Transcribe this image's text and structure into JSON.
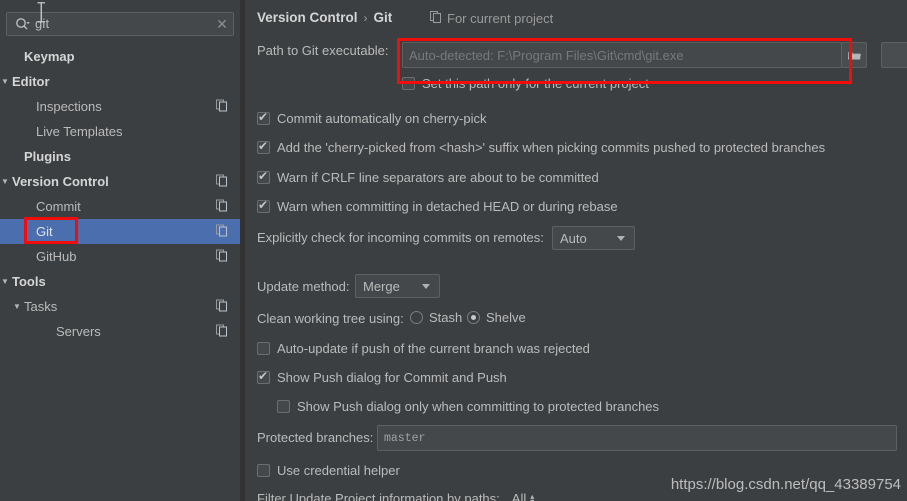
{
  "search": {
    "value": "git",
    "icon": "search-icon",
    "clear_icon": "clear-x-icon"
  },
  "sidebar": {
    "items": [
      {
        "label": "Keymap",
        "indent": 1,
        "bold": true,
        "arrow": "",
        "project_icon": false,
        "selected": false
      },
      {
        "label": "Editor",
        "indent": 0,
        "bold": true,
        "arrow": "▼",
        "project_icon": false,
        "selected": false
      },
      {
        "label": "Inspections",
        "indent": 2,
        "bold": false,
        "arrow": "",
        "project_icon": true,
        "selected": false
      },
      {
        "label": "Live Templates",
        "indent": 2,
        "bold": false,
        "arrow": "",
        "project_icon": false,
        "selected": false
      },
      {
        "label": "Plugins",
        "indent": 1,
        "bold": true,
        "arrow": "",
        "project_icon": false,
        "selected": false
      },
      {
        "label": "Version Control",
        "indent": 0,
        "bold": true,
        "arrow": "▼",
        "project_icon": true,
        "selected": false
      },
      {
        "label": "Commit",
        "indent": 2,
        "bold": false,
        "arrow": "",
        "project_icon": true,
        "selected": false
      },
      {
        "label": "Git",
        "indent": 2,
        "bold": false,
        "arrow": "",
        "project_icon": true,
        "selected": true
      },
      {
        "label": "GitHub",
        "indent": 2,
        "bold": false,
        "arrow": "",
        "project_icon": true,
        "selected": false
      },
      {
        "label": "Tools",
        "indent": 0,
        "bold": true,
        "arrow": "▼",
        "project_icon": false,
        "selected": false
      },
      {
        "label": "Tasks",
        "indent": 1,
        "bold": false,
        "arrow": "▼",
        "project_icon": true,
        "selected": false
      },
      {
        "label": "Servers",
        "indent": 3,
        "bold": false,
        "arrow": "",
        "project_icon": true,
        "selected": false
      }
    ]
  },
  "header": {
    "breadcrumb_root": "Version Control",
    "breadcrumb_sep": "›",
    "breadcrumb_leaf": "Git",
    "for_current_project": "For current project"
  },
  "git_settings": {
    "path_label": "Path to Git executable:",
    "path_placeholder": "Auto-detected: F:\\Program Files\\Git\\cmd\\git.exe",
    "browse_icon": "folder-browse-icon",
    "set_path_only_label": "Set this path only for the current project",
    "set_path_only_checked": false,
    "checkboxes": [
      {
        "label": "Commit automatically on cherry-pick",
        "checked": true
      },
      {
        "label": "Add the 'cherry-picked from <hash>' suffix when picking commits pushed to protected branches",
        "checked": true
      },
      {
        "label": "Warn if CRLF line separators are about to be committed",
        "checked": true
      },
      {
        "label": "Warn when committing in detached HEAD or during rebase",
        "checked": true
      }
    ],
    "incoming_label": "Explicitly check for incoming commits on remotes:",
    "incoming_value": "Auto",
    "update_method_label": "Update method:",
    "update_method_value": "Merge",
    "clean_tree_label": "Clean working tree using:",
    "clean_tree_options": [
      {
        "label": "Stash",
        "selected": false
      },
      {
        "label": "Shelve",
        "selected": true
      }
    ],
    "auto_update_label": "Auto-update if push of the current branch was rejected",
    "auto_update_checked": false,
    "show_push_label": "Show Push dialog for Commit and Push",
    "show_push_checked": true,
    "show_push_protected_label": "Show Push dialog only when committing to protected branches",
    "show_push_protected_checked": false,
    "protected_branches_label": "Protected branches:",
    "protected_branches_value": "master",
    "credential_helper_label": "Use credential helper",
    "credential_helper_checked": false,
    "filter_label": "Filter Update Project information by paths:",
    "filter_value": "All"
  },
  "annotations": {
    "highlight_color": "#f20d0d",
    "selection_color": "#4b6eaf"
  },
  "watermark": "https://blog.csdn.net/qq_43389754"
}
